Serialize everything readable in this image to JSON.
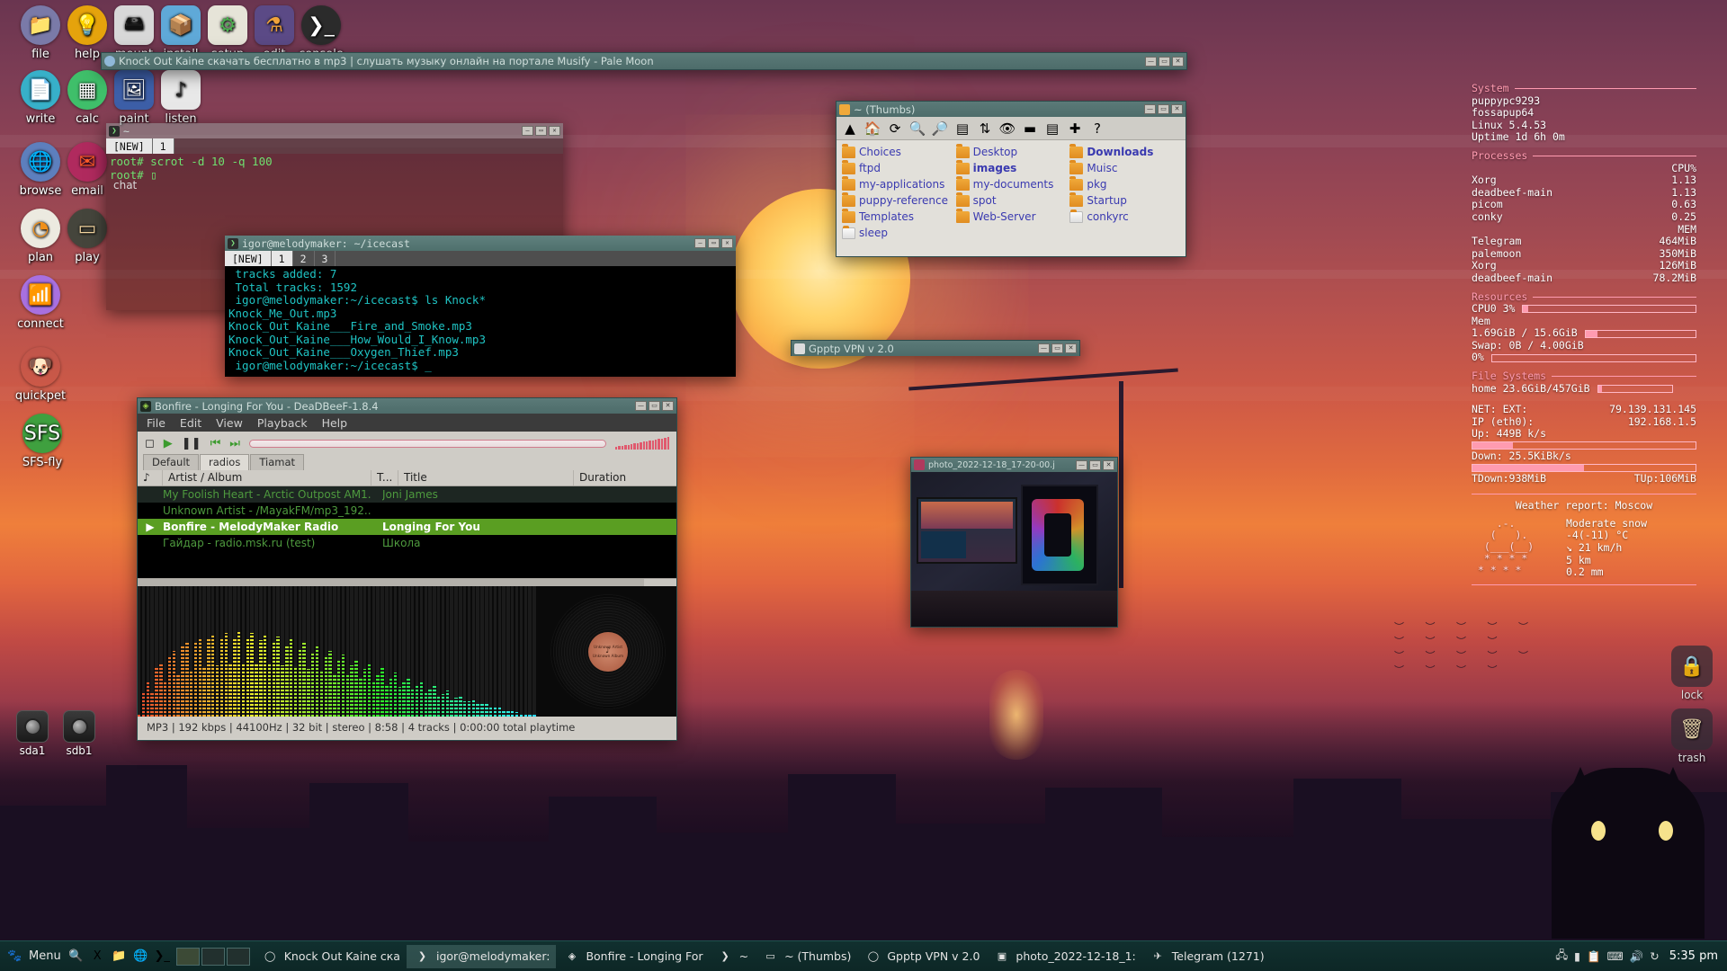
{
  "desktop": {
    "icons_row1": [
      {
        "label": "file",
        "icon": "folder-icon",
        "glyph": "📁",
        "bg": "#7a7aa8",
        "fg": "#f5c24a"
      },
      {
        "label": "help",
        "icon": "lightbulb-icon",
        "glyph": "💡",
        "bg": "#e5a30c",
        "fg": "#ffffff"
      },
      {
        "label": "mount",
        "icon": "harddisk-icon",
        "glyph": "🖴",
        "bg": "#d8d8d8",
        "fg": "#111111"
      },
      {
        "label": "install",
        "icon": "package-icon",
        "glyph": "📦",
        "bg": "#5fa9d8",
        "fg": "#f3c14e"
      },
      {
        "label": "setup",
        "icon": "toggles-icon",
        "glyph": "⚙",
        "bg": "#e6e4d8",
        "fg": "#4caf50"
      },
      {
        "label": "edit",
        "icon": "flask-icon",
        "glyph": "⚗",
        "bg": "#5b4a86",
        "fg": "#f0a23a"
      },
      {
        "label": "console",
        "icon": "terminal-icon",
        "glyph": "❯_",
        "bg": "#2b2b2b",
        "fg": "#ffffff"
      }
    ],
    "icons_row2": [
      {
        "label": "write",
        "icon": "document-icon",
        "glyph": "📄",
        "bg": "#37b0c9",
        "fg": "#ffffff"
      },
      {
        "label": "calc",
        "icon": "spreadsheet-icon",
        "glyph": "▦",
        "bg": "#3fbf6a",
        "fg": "#ffffff"
      },
      {
        "label": "paint",
        "icon": "image-icon",
        "glyph": "🖼",
        "bg": "#3d5fa8",
        "fg": "#ffffff"
      },
      {
        "label": "listen",
        "icon": "music-note-icon",
        "glyph": "♪",
        "bg": "#e8e8e8",
        "fg": "#222222"
      }
    ],
    "icons_col": [
      {
        "label": "browse",
        "icon": "globe-icon",
        "glyph": "🌐",
        "bg": "#5d7fbd",
        "fg": "#ffffff"
      },
      {
        "label": "email",
        "icon": "envelope-icon",
        "glyph": "✉",
        "bg": "#b02a5e",
        "fg": "#ff5a2a"
      },
      {
        "label": "plan",
        "icon": "clock-icon",
        "glyph": "◔",
        "bg": "#eceae0",
        "fg": "#f0901a"
      },
      {
        "label": "play",
        "icon": "card-deck-icon",
        "glyph": "▭",
        "bg": "#45453c",
        "fg": "#f4d6a0"
      },
      {
        "label": "connect",
        "icon": "wifi-icon",
        "glyph": "📶",
        "bg": "#a870e0",
        "fg": "#ffffff"
      },
      {
        "label": "quickpet",
        "icon": "puppy-icon",
        "glyph": "🐶",
        "bg": "transparent",
        "fg": "#dddddd"
      },
      {
        "label": "SFS-fly",
        "icon": "sfs-icon",
        "glyph": "SFS",
        "bg": "#3fa03f",
        "fg": "#ffffff"
      }
    ],
    "drives": [
      {
        "label": "sda1",
        "icon": "drive-icon"
      },
      {
        "label": "sdb1",
        "icon": "drive-icon"
      }
    ],
    "right_icons": [
      {
        "label": "lock",
        "icon": "padlock-icon",
        "glyph": "🔒"
      },
      {
        "label": "trash",
        "icon": "trash-icon",
        "glyph": "🗑"
      }
    ]
  },
  "palemoon": {
    "title": "Knock Out Kaine скачать бесплатно в mp3 | слушать музыку онлайн на портале Musify - Pale Moon",
    "icon": "palemoon-icon",
    "buttons": [
      "—",
      "▭",
      "✕"
    ]
  },
  "term1": {
    "title": "~",
    "icon": "terminal-icon",
    "tabs": [
      "[NEW]",
      "1"
    ],
    "selected_tab": "1",
    "lines": [
      "root# scrot -d 10 -q 100",
      "root# ▯"
    ],
    "overlay_text": "chat",
    "buttons": [
      "—",
      "▭",
      "✕"
    ]
  },
  "term2": {
    "title": "igor@melodymaker: ~/icecast",
    "icon": "terminal-icon",
    "tabs": [
      "[NEW]",
      "1",
      "2",
      "3"
    ],
    "selected_tab": "1",
    "lines": [
      " tracks added: 7",
      " Total tracks: 1592",
      " igor@melodymaker:~/icecast$ ls Knock*",
      "Knock_Me_Out.mp3",
      "Knock_Out_Kaine___Fire_and_Smoke.mp3",
      "Knock_Out_Kaine___How_Would_I_Know.mp3",
      "Knock_Out_Kaine___Oxygen_Thief.mp3",
      " igor@melodymaker:~/icecast$ _"
    ],
    "buttons": [
      "—",
      "▭",
      "✕"
    ]
  },
  "thumbs": {
    "title": "~ (Thumbs)",
    "icon": "folder-icon",
    "buttons": [
      "—",
      "▭",
      "✕"
    ],
    "toolbar": [
      {
        "name": "up-icon",
        "glyph": "▲"
      },
      {
        "name": "home-icon",
        "glyph": "🏠"
      },
      {
        "name": "refresh-icon",
        "glyph": "⟳"
      },
      {
        "name": "zoom-in-icon",
        "glyph": "🔍"
      },
      {
        "name": "zoom-out-icon",
        "glyph": "🔎"
      },
      {
        "name": "list-view-icon",
        "glyph": "▤"
      },
      {
        "name": "sort-az-icon",
        "glyph": "⇅"
      },
      {
        "name": "eye-icon",
        "glyph": "👁"
      },
      {
        "name": "folder-icon",
        "glyph": "▬"
      },
      {
        "name": "details-icon",
        "glyph": "▤"
      },
      {
        "name": "new-icon",
        "glyph": "✚"
      },
      {
        "name": "help-icon",
        "glyph": "?"
      }
    ],
    "entries": [
      {
        "name": "Choices",
        "type": "folder",
        "bold": false
      },
      {
        "name": "Desktop",
        "type": "folder",
        "bold": false
      },
      {
        "name": "Downloads",
        "type": "folder",
        "bold": true
      },
      {
        "name": "ftpd",
        "type": "folder",
        "bold": false
      },
      {
        "name": "images",
        "type": "folder",
        "bold": true
      },
      {
        "name": "Muisc",
        "type": "folder",
        "bold": false
      },
      {
        "name": "my-applications",
        "type": "folder",
        "bold": false
      },
      {
        "name": "my-documents",
        "type": "folder",
        "bold": false
      },
      {
        "name": "pkg",
        "type": "folder",
        "bold": false
      },
      {
        "name": "puppy-reference",
        "type": "folder",
        "bold": false
      },
      {
        "name": "spot",
        "type": "folder",
        "bold": false
      },
      {
        "name": "Startup",
        "type": "folder",
        "bold": false
      },
      {
        "name": "Templates",
        "type": "folder",
        "bold": false
      },
      {
        "name": "Web-Server",
        "type": "folder",
        "bold": false
      },
      {
        "name": "conkyrc",
        "type": "file",
        "bold": false
      },
      {
        "name": "sleep",
        "type": "file",
        "bold": false
      }
    ]
  },
  "gpptp": {
    "title": "Gpptp VPN v 2.0",
    "icon": "app-icon",
    "buttons": [
      "—",
      "▭",
      "✕"
    ]
  },
  "photo": {
    "title": "photo_2022-12-18_17-20-00.j",
    "icon": "image-icon",
    "buttons": [
      "—",
      "▭",
      "✕"
    ]
  },
  "deadbeef": {
    "title": "Bonfire - Longing For You - DeaDBeeF-1.8.4",
    "icon": "deadbeef-icon",
    "buttons": [
      "—",
      "▭",
      "✕"
    ],
    "menu": [
      "File",
      "Edit",
      "View",
      "Playback",
      "Help"
    ],
    "controls": [
      {
        "name": "stop-button",
        "glyph": "◻"
      },
      {
        "name": "play-button",
        "glyph": "▶"
      },
      {
        "name": "pause-button",
        "glyph": "❚❚"
      },
      {
        "name": "prev-button",
        "glyph": "⏮"
      },
      {
        "name": "next-button",
        "glyph": "⏭"
      }
    ],
    "tabs": [
      "Default",
      "radios",
      "Tiamat"
    ],
    "selected_tab": "radios",
    "columns": [
      "♪",
      "Artist / Album",
      "T...",
      "Title",
      "Duration"
    ],
    "rows": [
      {
        "play": "",
        "artist": "My Foolish Heart - Arctic Outpost AM1...",
        "t": "",
        "title": "Joni James",
        "duration": "",
        "state": "alt"
      },
      {
        "play": "",
        "artist": "Unknown Artist - /MayakFM/mp3_192...",
        "t": "",
        "title": "",
        "duration": "",
        "state": "normal"
      },
      {
        "play": "▶",
        "artist": "Bonfire - MelodyMaker Radio",
        "t": "",
        "title": "Longing For You",
        "duration": "",
        "state": "playing"
      },
      {
        "play": "",
        "artist": "Гайдар - radio.msk.ru (test)",
        "t": "",
        "title": "Школа",
        "duration": "",
        "state": "normal"
      }
    ],
    "album_label_lines": [
      "Unknown Artist",
      "♪",
      "Unknown Album"
    ],
    "status": "MP3 | 192 kbps | 44100Hz | 32 bit | stereo | 8:58 | 4 tracks | 0:00:00 total playtime"
  },
  "taskbar": {
    "menu_label": "Menu",
    "launchers": [
      {
        "name": "search-icon",
        "glyph": "🔍"
      },
      {
        "name": "xine-icon",
        "glyph": "X"
      },
      {
        "name": "folder-icon",
        "glyph": "📁"
      },
      {
        "name": "globe-icon",
        "glyph": "🌐"
      },
      {
        "name": "terminal-icon",
        "glyph": "❯_"
      }
    ],
    "pager": [
      "1",
      "2",
      "3"
    ],
    "windows": [
      {
        "label": "Knock Out Kaine ска",
        "icon": "palemoon-icon",
        "active": false
      },
      {
        "label": "igor@melodymaker:",
        "icon": "terminal-icon",
        "active": true
      },
      {
        "label": "Bonfire - Longing For",
        "icon": "deadbeef-icon",
        "active": false
      },
      {
        "label": "~",
        "icon": "terminal-icon",
        "active": false
      },
      {
        "label": "~ (Thumbs)",
        "icon": "folder-icon",
        "active": false
      },
      {
        "label": "Gpptp VPN v 2.0",
        "icon": "app-icon",
        "active": false
      },
      {
        "label": "photo_2022-12-18_1:",
        "icon": "image-icon",
        "active": false
      },
      {
        "label": "Telegram (1271)",
        "icon": "telegram-icon",
        "active": false
      }
    ],
    "tray": [
      {
        "name": "network-icon",
        "glyph": "🖧"
      },
      {
        "name": "battery-icon",
        "glyph": "▮"
      },
      {
        "name": "clipboard-icon",
        "glyph": "📋"
      },
      {
        "name": "keyboard-icon",
        "glyph": "⌨"
      },
      {
        "name": "volume-icon",
        "glyph": "🔊"
      },
      {
        "name": "update-icon",
        "glyph": "↻"
      }
    ],
    "clock": "5:35 pm"
  },
  "conky": {
    "system_header": "System",
    "system_lines": [
      "puppypc9293",
      "fossapup64",
      "Linux 5.4.53",
      "Uptime 1d 6h 0m"
    ],
    "processes_header": "Processes",
    "cpu_col": "CPU%",
    "cpu_procs": [
      {
        "name": "Xorg",
        "value": "1.13"
      },
      {
        "name": "deadbeef-main",
        "value": "1.13"
      },
      {
        "name": "picom",
        "value": "0.63"
      },
      {
        "name": "conky",
        "value": "0.25"
      }
    ],
    "mem_col": "MEM",
    "mem_procs": [
      {
        "name": "Telegram",
        "value": "464MiB"
      },
      {
        "name": "palemoon",
        "value": "350MiB"
      },
      {
        "name": "Xorg",
        "value": "126MiB"
      },
      {
        "name": "deadbeef-main",
        "value": "78.2MiB"
      }
    ],
    "resources_header": "Resources",
    "cpu0_label": "CPU0 3%",
    "cpu0_pct": 3,
    "mem_label": "Mem",
    "mem_value": "1.69GiB / 15.6GiB",
    "mem_pct": 11,
    "swap_value": "Swap: 0B   / 4.00GiB",
    "swap_label": "0%",
    "swap_pct": 0,
    "fs_header": "File Systems",
    "fs_label": "home 23.6GiB/457GiB",
    "fs_pct": 5,
    "net_ext_label": "NET: EXT:",
    "net_ext_value": "79.139.131.145",
    "net_ip_label": "IP (eth0):",
    "net_ip_value": "192.168.1.5",
    "up_label": "Up: 449B   k/s",
    "up_pct": 18,
    "down_label": "Down: 25.5KiBk/s",
    "down_pct": 50,
    "tdown": "TDown:938MiB",
    "tup": "TUp:106MiB",
    "weather_header": "Weather report: Moscow",
    "weather_art": "    .-.\n   (   ).\n  (___(__)\n  * * * *\n * * * *",
    "weather_cond": "Moderate snow",
    "weather_temp": "-4(-11) °C",
    "weather_wind": "↘ 21 km/h",
    "weather_vis": "5 km",
    "weather_precip": "0.2 mm"
  }
}
